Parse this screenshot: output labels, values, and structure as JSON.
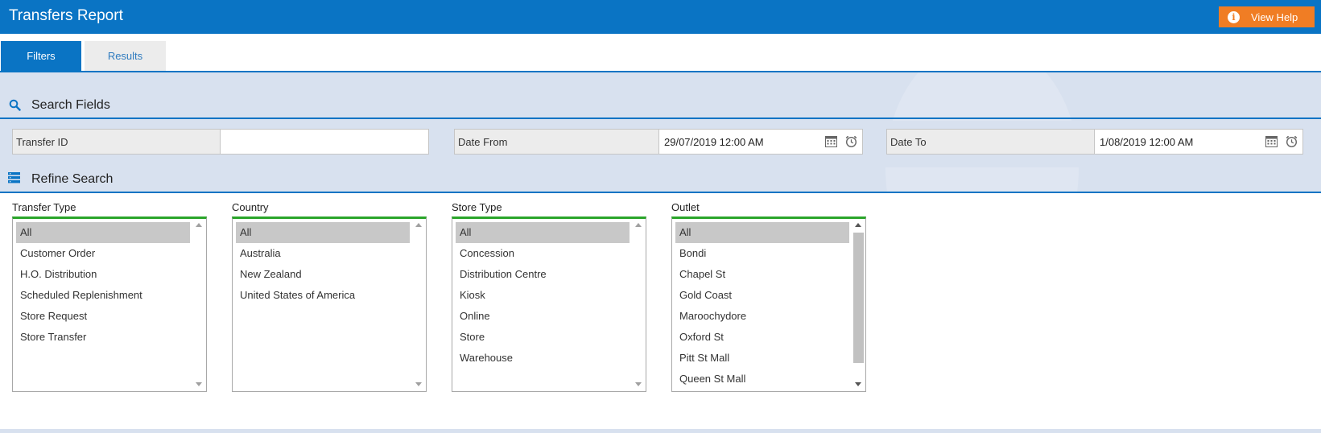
{
  "header": {
    "title": "Transfers Report",
    "help_label": "View Help",
    "help_icon": "info-icon",
    "bar_color": "#0a74c4",
    "help_color": "#f07d24"
  },
  "tabs": [
    {
      "label": "Filters",
      "active": true
    },
    {
      "label": "Results",
      "active": false
    }
  ],
  "search_fields": {
    "title": "Search Fields",
    "icon": "search-icon",
    "transfer_id": {
      "label": "Transfer ID",
      "value": ""
    },
    "date_from": {
      "label": "Date From",
      "value": "29/07/2019 12:00 AM"
    },
    "date_to": {
      "label": "Date To",
      "value": "1/08/2019 12:00 AM"
    }
  },
  "refine_search": {
    "title": "Refine Search",
    "icon": "list-icon",
    "lists": [
      {
        "label": "Transfer Type",
        "selected": "All",
        "options": [
          "All",
          "Customer Order",
          "H.O. Distribution",
          "Scheduled Replenishment",
          "Store Request",
          "Store Transfer"
        ]
      },
      {
        "label": "Country",
        "selected": "All",
        "options": [
          "All",
          "Australia",
          "New Zealand",
          "United States of America"
        ]
      },
      {
        "label": "Store Type",
        "selected": "All",
        "options": [
          "All",
          "Concession",
          "Distribution Centre",
          "Kiosk",
          "Online",
          "Store",
          "Warehouse"
        ]
      },
      {
        "label": "Outlet",
        "selected": "All",
        "options": [
          "All",
          "Bondi",
          "Chapel St",
          "Gold Coast",
          "Maroochydore",
          "Oxford St",
          "Pitt St Mall",
          "Queen St Mall"
        ]
      }
    ]
  }
}
